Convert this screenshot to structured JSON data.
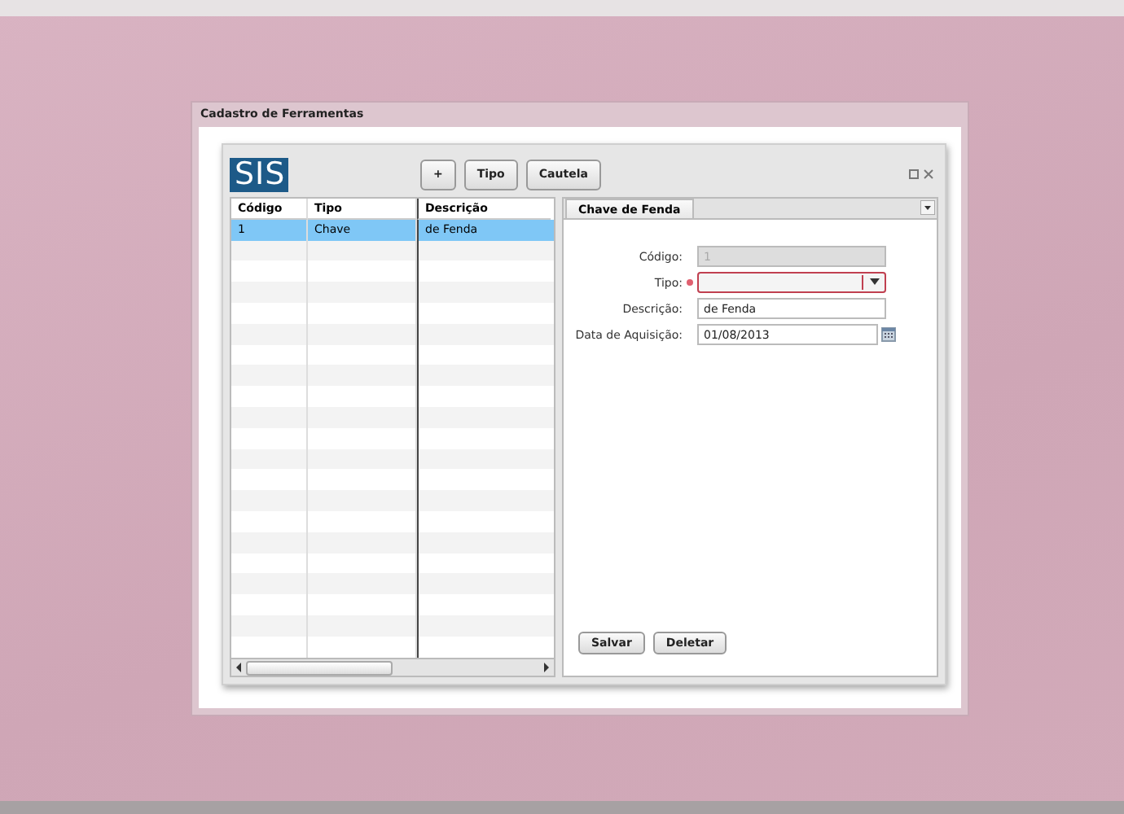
{
  "window": {
    "title": "Cadastro de Ferramentas"
  },
  "logo": "SIS",
  "toolbar": [
    {
      "label": "+"
    },
    {
      "label": "Tipo"
    },
    {
      "label": "Cautela"
    }
  ],
  "table": {
    "columns": [
      "Código",
      "Tipo",
      "Descrição"
    ],
    "rows": [
      {
        "cells": [
          "1",
          "Chave",
          "de Fenda"
        ],
        "selected": true
      }
    ]
  },
  "form": {
    "tab": "Chave de Fenda",
    "fields": [
      {
        "kind": "text",
        "label": "Código:",
        "value": "1",
        "disabled": true,
        "required": false
      },
      {
        "kind": "select",
        "label": "Tipo:",
        "disabled": false,
        "required": true
      },
      {
        "kind": "text",
        "label": "Descrição:",
        "value": "de Fenda",
        "disabled": false,
        "required": false
      },
      {
        "kind": "date",
        "label": "Data de Aquisição:",
        "value": "01/08/2013",
        "disabled": false,
        "required": false
      }
    ],
    "buttons": [
      "Salvar",
      "Deletar"
    ]
  }
}
